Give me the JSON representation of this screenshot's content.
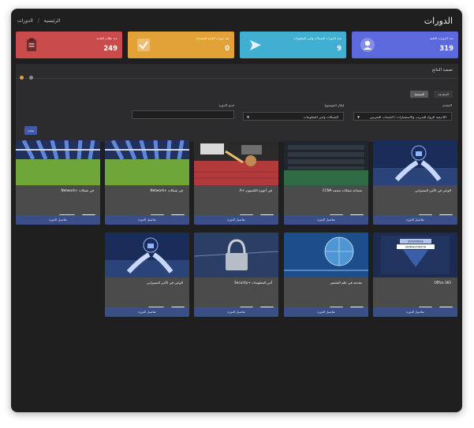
{
  "header": {
    "title": "الدورات",
    "breadcrumb": {
      "home": "الرئيسية",
      "separator": "/",
      "current": "الدورات"
    }
  },
  "stats": [
    {
      "label": "عدد الدورات العامة",
      "value": "319",
      "color": "#5b69dd",
      "icon": "user-icon"
    },
    {
      "label": "عدد الدورات الشبكات وامن المعلومات",
      "value": "9",
      "color": "#41afd1",
      "icon": "paper-plane-icon"
    },
    {
      "label": "عدد دورات العامة المتقدمة",
      "value": "0",
      "color": "#e2a237",
      "icon": "checkbox-icon"
    },
    {
      "label": "عدد طلاب العامة",
      "value": "249",
      "color": "#c94b4b",
      "icon": "clipboard-icon"
    }
  ],
  "filter": {
    "title": "تصفية النتائج",
    "tabs": [
      {
        "label": "المنسقة",
        "active": true
      },
      {
        "label": "المتقدمة",
        "active": false
      }
    ],
    "fields": {
      "provider": {
        "label": "المقدم",
        "value": "اكاديمية الرواد للتدريب والاستشارات / الحساب التجريبي"
      },
      "framework": {
        "label": "إطار الموضوع",
        "value": "الشبكات وامن المعلومات"
      },
      "course_name": {
        "label": "اسم الدورة",
        "placeholder": ""
      }
    },
    "search_label": "بحث"
  },
  "cards": [
    {
      "title": "الوعي في الأمن السيبراني",
      "badges": [
        {
          "label": "عربي",
          "type": "paid"
        },
        {
          "label": "مجانية",
          "type": "free"
        }
      ],
      "footer": "تفاصيل الدورة",
      "thumb": "cyber"
    },
    {
      "title": "مساعد شبكات معتمد CCNA",
      "badges": [
        {
          "label": "عربي",
          "type": "paid"
        },
        {
          "label": "مجانية",
          "type": "free"
        }
      ],
      "footer": "تفاصيل الدورة",
      "thumb": "server"
    },
    {
      "title": "في أجهزة الكمبيوتر +A",
      "badges": [
        {
          "label": "عربي",
          "type": "paid"
        },
        {
          "label": "مجانية",
          "type": "free"
        }
      ],
      "footer": "تفاصيل الدورة",
      "thumb": "board"
    },
    {
      "title": "في شبكات +Network",
      "badges": [
        {
          "label": "عربي",
          "type": "paid"
        },
        {
          "label": "مجانية",
          "type": "free"
        }
      ],
      "footer": "تفاصيل الدورة",
      "thumb": "cables"
    },
    {
      "title": "في شبكات +Network",
      "badges": [
        {
          "label": "انجليزي",
          "type": "paid"
        },
        {
          "label": "مجانية",
          "type": "free"
        }
      ],
      "footer": "تفاصيل الدورة",
      "thumb": "cables"
    },
    {
      "title": "Office 365",
      "badges": [
        {
          "label": "عربي",
          "type": "paid"
        },
        {
          "label": "مجانية",
          "type": "free"
        }
      ],
      "footer": "تفاصيل الدورة",
      "thumb": "badge",
      "thumb_text": {
        "line1": "ENTERPRISE",
        "line2": "ADMINISTRATOR"
      }
    },
    {
      "title": "مقدمة في علم التشفير",
      "badges": [
        {
          "label": "عربي",
          "type": "paid"
        },
        {
          "label": "مجانية",
          "type": "free"
        }
      ],
      "footer": "تفاصيل الدورة",
      "thumb": "globe"
    },
    {
      "title": "أمن المعلومات +Security",
      "badges": [
        {
          "label": "عربي",
          "type": "paid"
        },
        {
          "label": "مجانية",
          "type": "free"
        }
      ],
      "footer": "تفاصيل الدورة",
      "thumb": "lock"
    },
    {
      "title": "الوعي في الأمن السيبراني",
      "badges": [
        {
          "label": "انجليزي",
          "type": "paid"
        },
        {
          "label": "مجانية",
          "type": "free"
        }
      ],
      "footer": "تفاصيل الدورة",
      "thumb": "cyber"
    }
  ]
}
